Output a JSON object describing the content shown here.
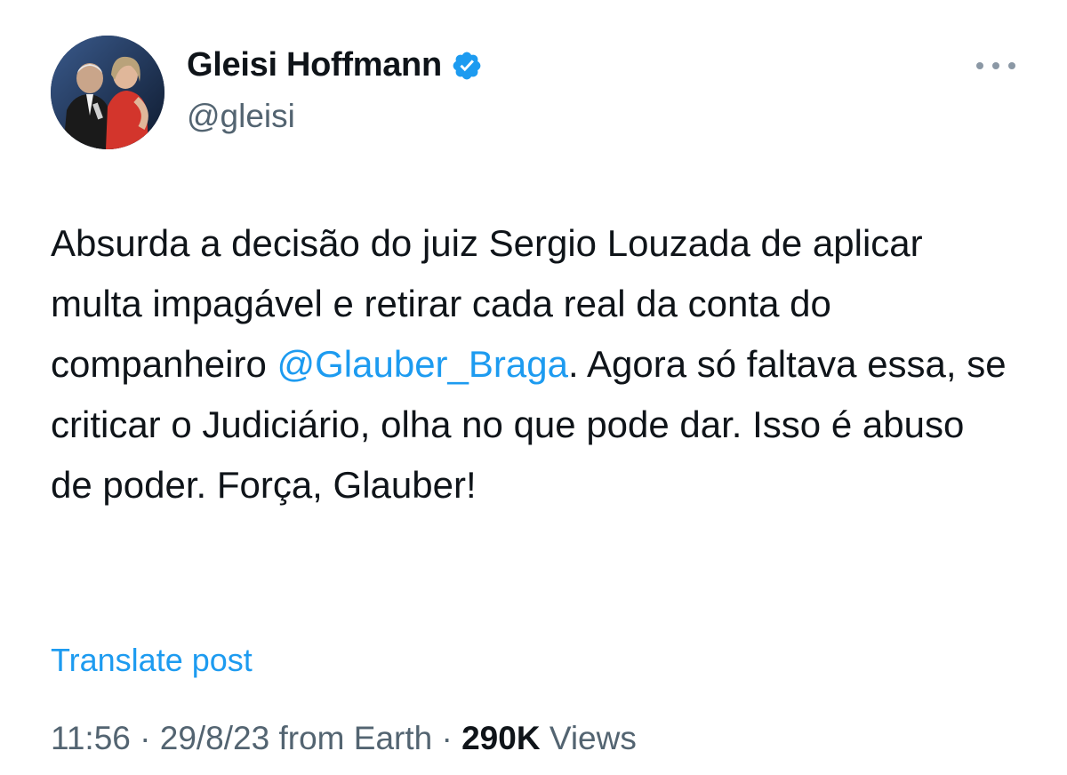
{
  "author": {
    "display_name": "Gleisi Hoffmann",
    "handle": "@gleisi",
    "verified_icon": "verified-badge-icon",
    "avatar": "profile-photo"
  },
  "post": {
    "text_before": "Absurda a decisão do juiz Sergio Louzada de aplicar multa impagável e retirar cada real da conta do companheiro ",
    "mention": "@Glauber_Braga",
    "text_after": ". Agora só faltava essa, se criticar o Judiciário, olha no que pode dar. Isso é abuso de poder. Força, Glauber!"
  },
  "translate_label": "Translate post",
  "meta": {
    "time": "11:56",
    "sep1": " · ",
    "date": "29/8/23",
    "source": " from Earth",
    "sep2": " · ",
    "views_count": "290K",
    "views_label": " Views"
  },
  "colors": {
    "link": "#1d9bf0",
    "secondary_text": "#536471",
    "primary_text": "#0f1419"
  },
  "icons": {
    "more": "more-options-icon"
  }
}
